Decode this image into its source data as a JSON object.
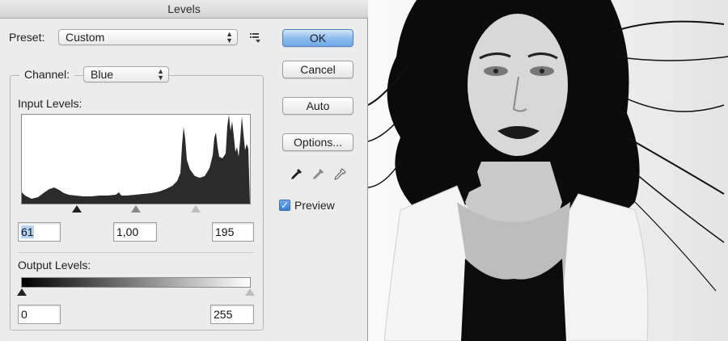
{
  "window": {
    "title": "Levels"
  },
  "preset": {
    "label": "Preset:",
    "value": "Custom"
  },
  "channel": {
    "label": "Channel:",
    "value": "Blue"
  },
  "input_levels": {
    "label": "Input Levels:",
    "black_value": "61",
    "gamma_value": "1,00",
    "white_value": "195"
  },
  "output_levels": {
    "label": "Output Levels:",
    "black_value": "0",
    "white_value": "255"
  },
  "buttons": {
    "ok": "OK",
    "cancel": "Cancel",
    "auto": "Auto",
    "options": "Options..."
  },
  "preview": {
    "label": "Preview",
    "checked": true
  },
  "icons": {
    "preset_menu": "preset-options-icon",
    "black_eyedropper": "black-eyedropper-icon",
    "gray_eyedropper": "gray-eyedropper-icon",
    "white_eyedropper": "white-eyedropper-icon"
  },
  "colors": {
    "ok_accent": "#7fb3ee",
    "checkbox": "#3b7fd6"
  }
}
